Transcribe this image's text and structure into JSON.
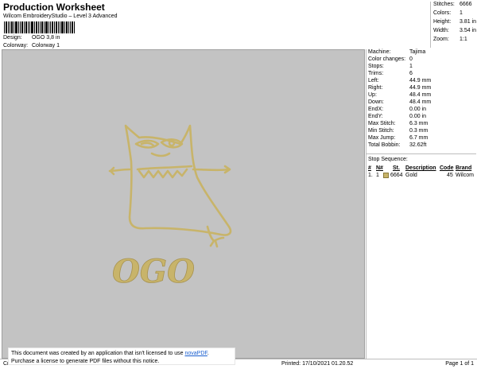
{
  "header": {
    "title": "Production Worksheet",
    "subtitle": "Wilcom EmbroideryStudio – Level 3 Advanced",
    "design_label": "Design:",
    "design_value": "OGO 3,8 in",
    "colorway_label": "Colorway:",
    "colorway_value": "Colorway 1"
  },
  "stats": [
    {
      "label": "Stitches:",
      "value": "6666"
    },
    {
      "label": "Colors:",
      "value": "1"
    },
    {
      "label": "Height:",
      "value": "3.81 in"
    },
    {
      "label": "Width:",
      "value": "3.54 in"
    },
    {
      "label": "Zoom:",
      "value": "1:1"
    }
  ],
  "machine_info": [
    {
      "label": "Machine:",
      "value": "Tajima"
    },
    {
      "label": "Color changes:",
      "value": "0"
    },
    {
      "label": "Stops:",
      "value": "1"
    },
    {
      "label": "Trims:",
      "value": "6"
    },
    {
      "label": "Left:",
      "value": "44.9 mm"
    },
    {
      "label": "Right:",
      "value": "44.9 mm"
    },
    {
      "label": "Up:",
      "value": "48.4 mm"
    },
    {
      "label": "Down:",
      "value": "48.4 mm"
    },
    {
      "label": "EndX:",
      "value": "0.00 in"
    },
    {
      "label": "EndY:",
      "value": "0.00 in"
    },
    {
      "label": "Max Stitch:",
      "value": "6.3 mm"
    },
    {
      "label": "Min Stitch:",
      "value": "0.3 mm"
    },
    {
      "label": "Max Jump:",
      "value": "6.7 mm"
    },
    {
      "label": "Total Bobbin:",
      "value": "32.62ft"
    }
  ],
  "stop_sequence": {
    "title": "Stop Sequence:",
    "headers": [
      "#",
      "N#",
      "St.",
      "Description",
      "Code",
      "Brand"
    ],
    "rows": [
      {
        "num": "1.",
        "n": "1",
        "st": "6664",
        "description": "Gold",
        "code": "45",
        "brand": "Wilcom"
      }
    ]
  },
  "design_text": "OGO",
  "colors": {
    "thread_gold": "#c8b46a",
    "canvas": "#c3c3c3"
  },
  "notice": {
    "line1_prefix": "This document was created by an application that isn't licensed to use ",
    "link": "novaPDF",
    "line1_suffix": ".",
    "line2": "Purchase a license to generate PDF files without this notice."
  },
  "footer": {
    "left": "Cr",
    "printed": "Printed: 17/10/2021 01.20.52",
    "page": "Page 1 of 1"
  }
}
